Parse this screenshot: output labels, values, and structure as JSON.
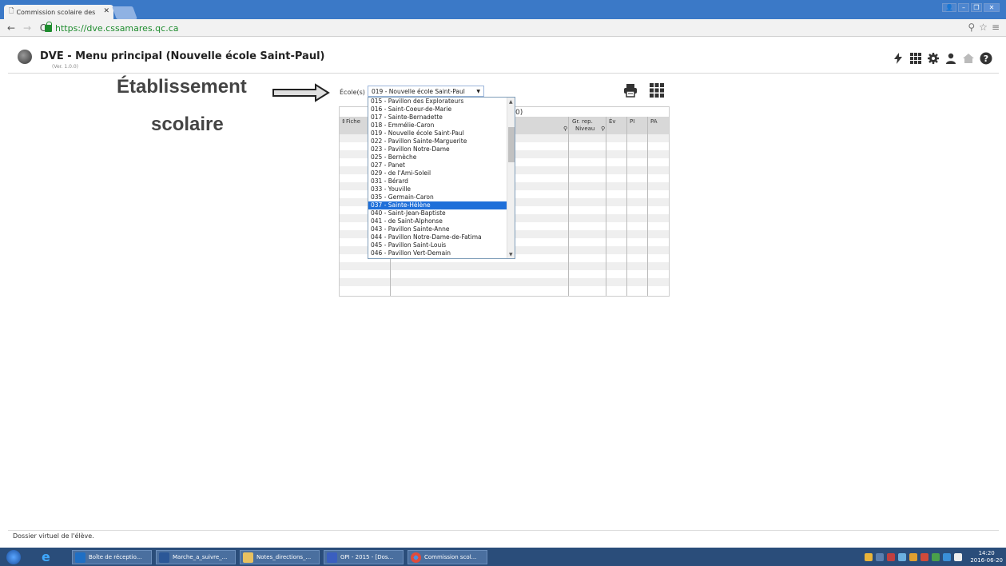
{
  "browser": {
    "tab_title": "Commission scolaire des",
    "url": "https://dve.cssamares.qc.ca"
  },
  "app": {
    "title": "DVE - Menu principal (Nouvelle école Saint-Paul)",
    "version": "(Ver. 1.0.0)"
  },
  "annotation": {
    "line1": "Établissement",
    "line2": "scolaire"
  },
  "ecole": {
    "label": "École(s)",
    "selected": "019 - Nouvelle école Saint-Paul",
    "options": [
      "015 - Pavillon des Explorateurs",
      "016 - Saint-Coeur-de-Marie",
      "017 - Sainte-Bernadette",
      "018 - Emmélie-Caron",
      "019 - Nouvelle école Saint-Paul",
      "022 - Pavillon Sainte-Marguerite",
      "023 - Pavillon Notre-Dame",
      "025 - Bernèche",
      "027 - Panet",
      "029 - de l'Ami-Soleil",
      "031 - Bérard",
      "033 - Youville",
      "035 - Germain-Caron",
      "037 - Sainte-Hélène",
      "040 - Saint-Jean-Baptiste",
      "041 - de Saint-Alphonse",
      "043 - Pavillon Sainte-Anne",
      "044 - Pavillon Notre-Dame-de-Fatima",
      "045 - Pavillon Saint-Louis",
      "046 - Pavillon Vert-Demain"
    ],
    "highlighted": "037 - Sainte-Hélène"
  },
  "table": {
    "title_suffix": "0)",
    "headers": {
      "fiche": "Fiche",
      "gr_rep": "Gr. rep.",
      "niveau": "Niveau",
      "ev": "Év",
      "pi": "PI",
      "pa": "PA"
    }
  },
  "statusbar": {
    "text": "Dossier virtuel de l'élève."
  },
  "taskbar": {
    "items": [
      "Boîte de réceptio...",
      "Marche_a_suivre_...",
      "Notes_directions_...",
      "GPI - 2015 - [Dos...",
      "Commission scol..."
    ],
    "time": "14:20",
    "date": "2016-06-20"
  }
}
